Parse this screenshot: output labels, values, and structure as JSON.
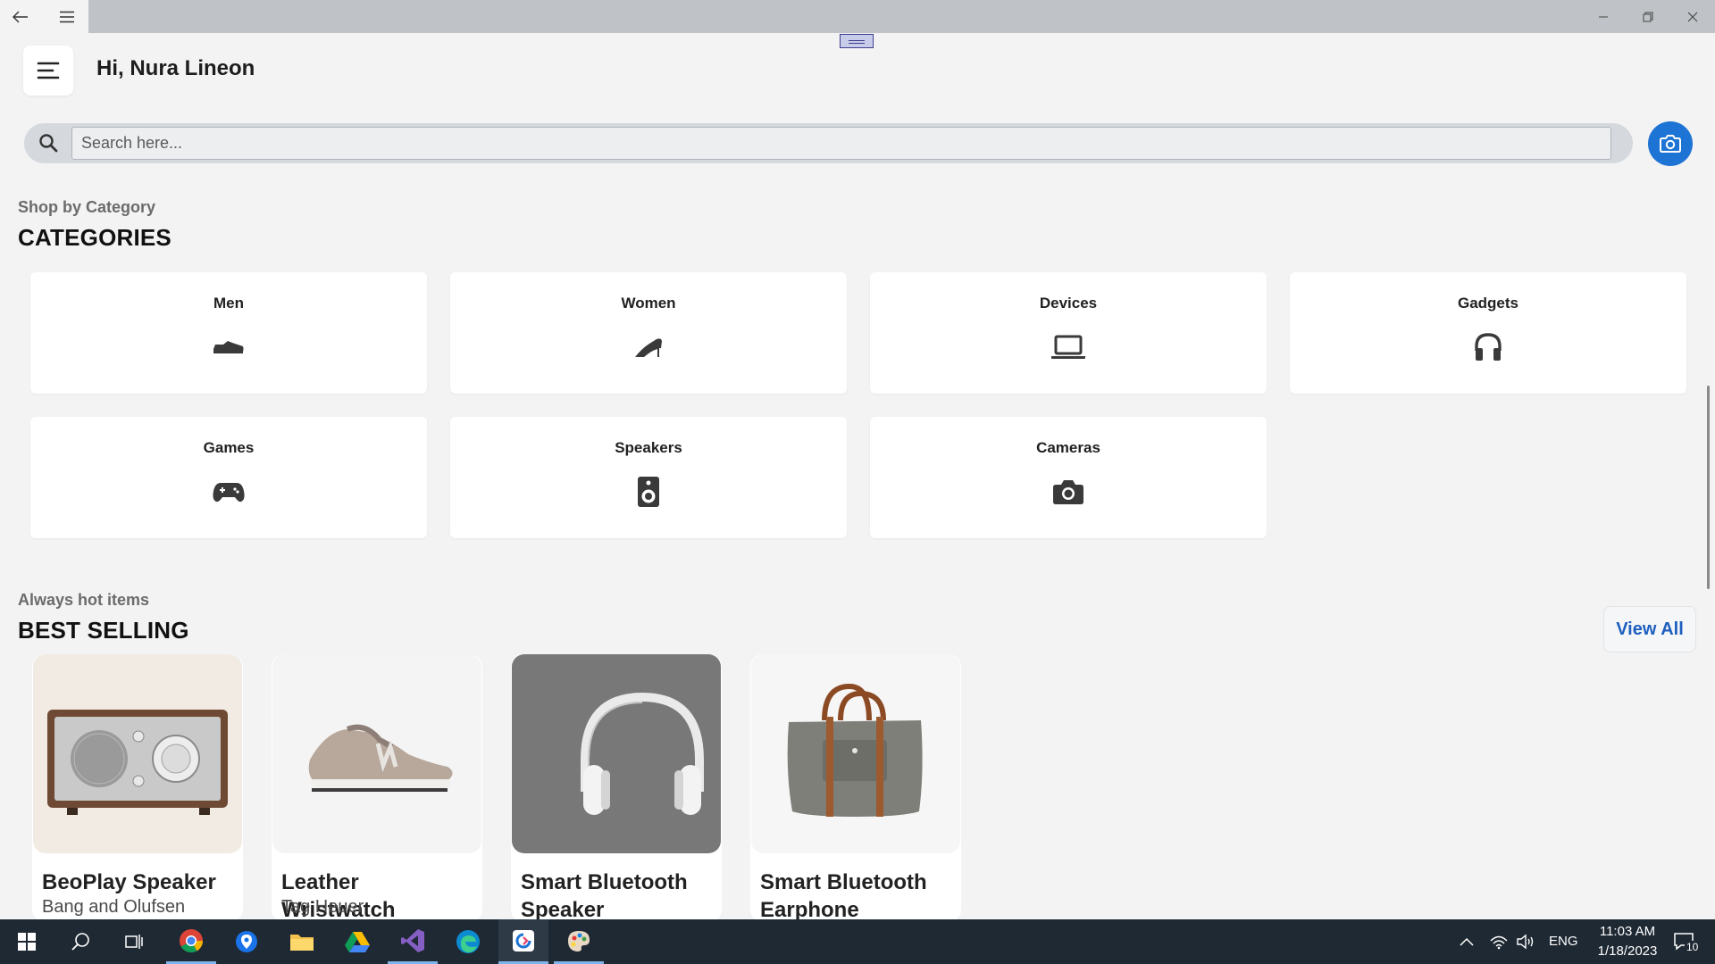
{
  "header": {
    "greeting": "Hi, Nura Lineon"
  },
  "search": {
    "placeholder": "Search here..."
  },
  "categories_section": {
    "subtitle": "Shop by Category",
    "title": "CATEGORIES",
    "items": [
      {
        "label": "Men",
        "icon": "mens-shoe-icon"
      },
      {
        "label": "Women",
        "icon": "high-heel-icon"
      },
      {
        "label": "Devices",
        "icon": "laptop-icon"
      },
      {
        "label": "Gadgets",
        "icon": "headphones-icon"
      },
      {
        "label": "Games",
        "icon": "gamepad-icon"
      },
      {
        "label": "Speakers",
        "icon": "speaker-icon"
      },
      {
        "label": "Cameras",
        "icon": "camera-icon"
      }
    ]
  },
  "best_selling": {
    "subtitle": "Always hot items",
    "title": "BEST SELLING",
    "view_all_label": "View All",
    "products": [
      {
        "name": "BeoPlay Speaker",
        "brand": "Bang and Olufsen"
      },
      {
        "name": "Leather Wristwatch",
        "brand": "Tag Heuer"
      },
      {
        "name": "Smart Bluetooth Speaker",
        "brand": ""
      },
      {
        "name": "Smart Bluetooth Earphone",
        "brand": ""
      }
    ]
  },
  "taskbar": {
    "language": "ENG",
    "time": "11:03 AM",
    "date": "1/18/2023",
    "notification_count": "10"
  },
  "colors": {
    "accent": "#1e74d4",
    "link": "#1e5fbf",
    "background": "#f3f3f3",
    "taskbar": "#1f2933"
  }
}
